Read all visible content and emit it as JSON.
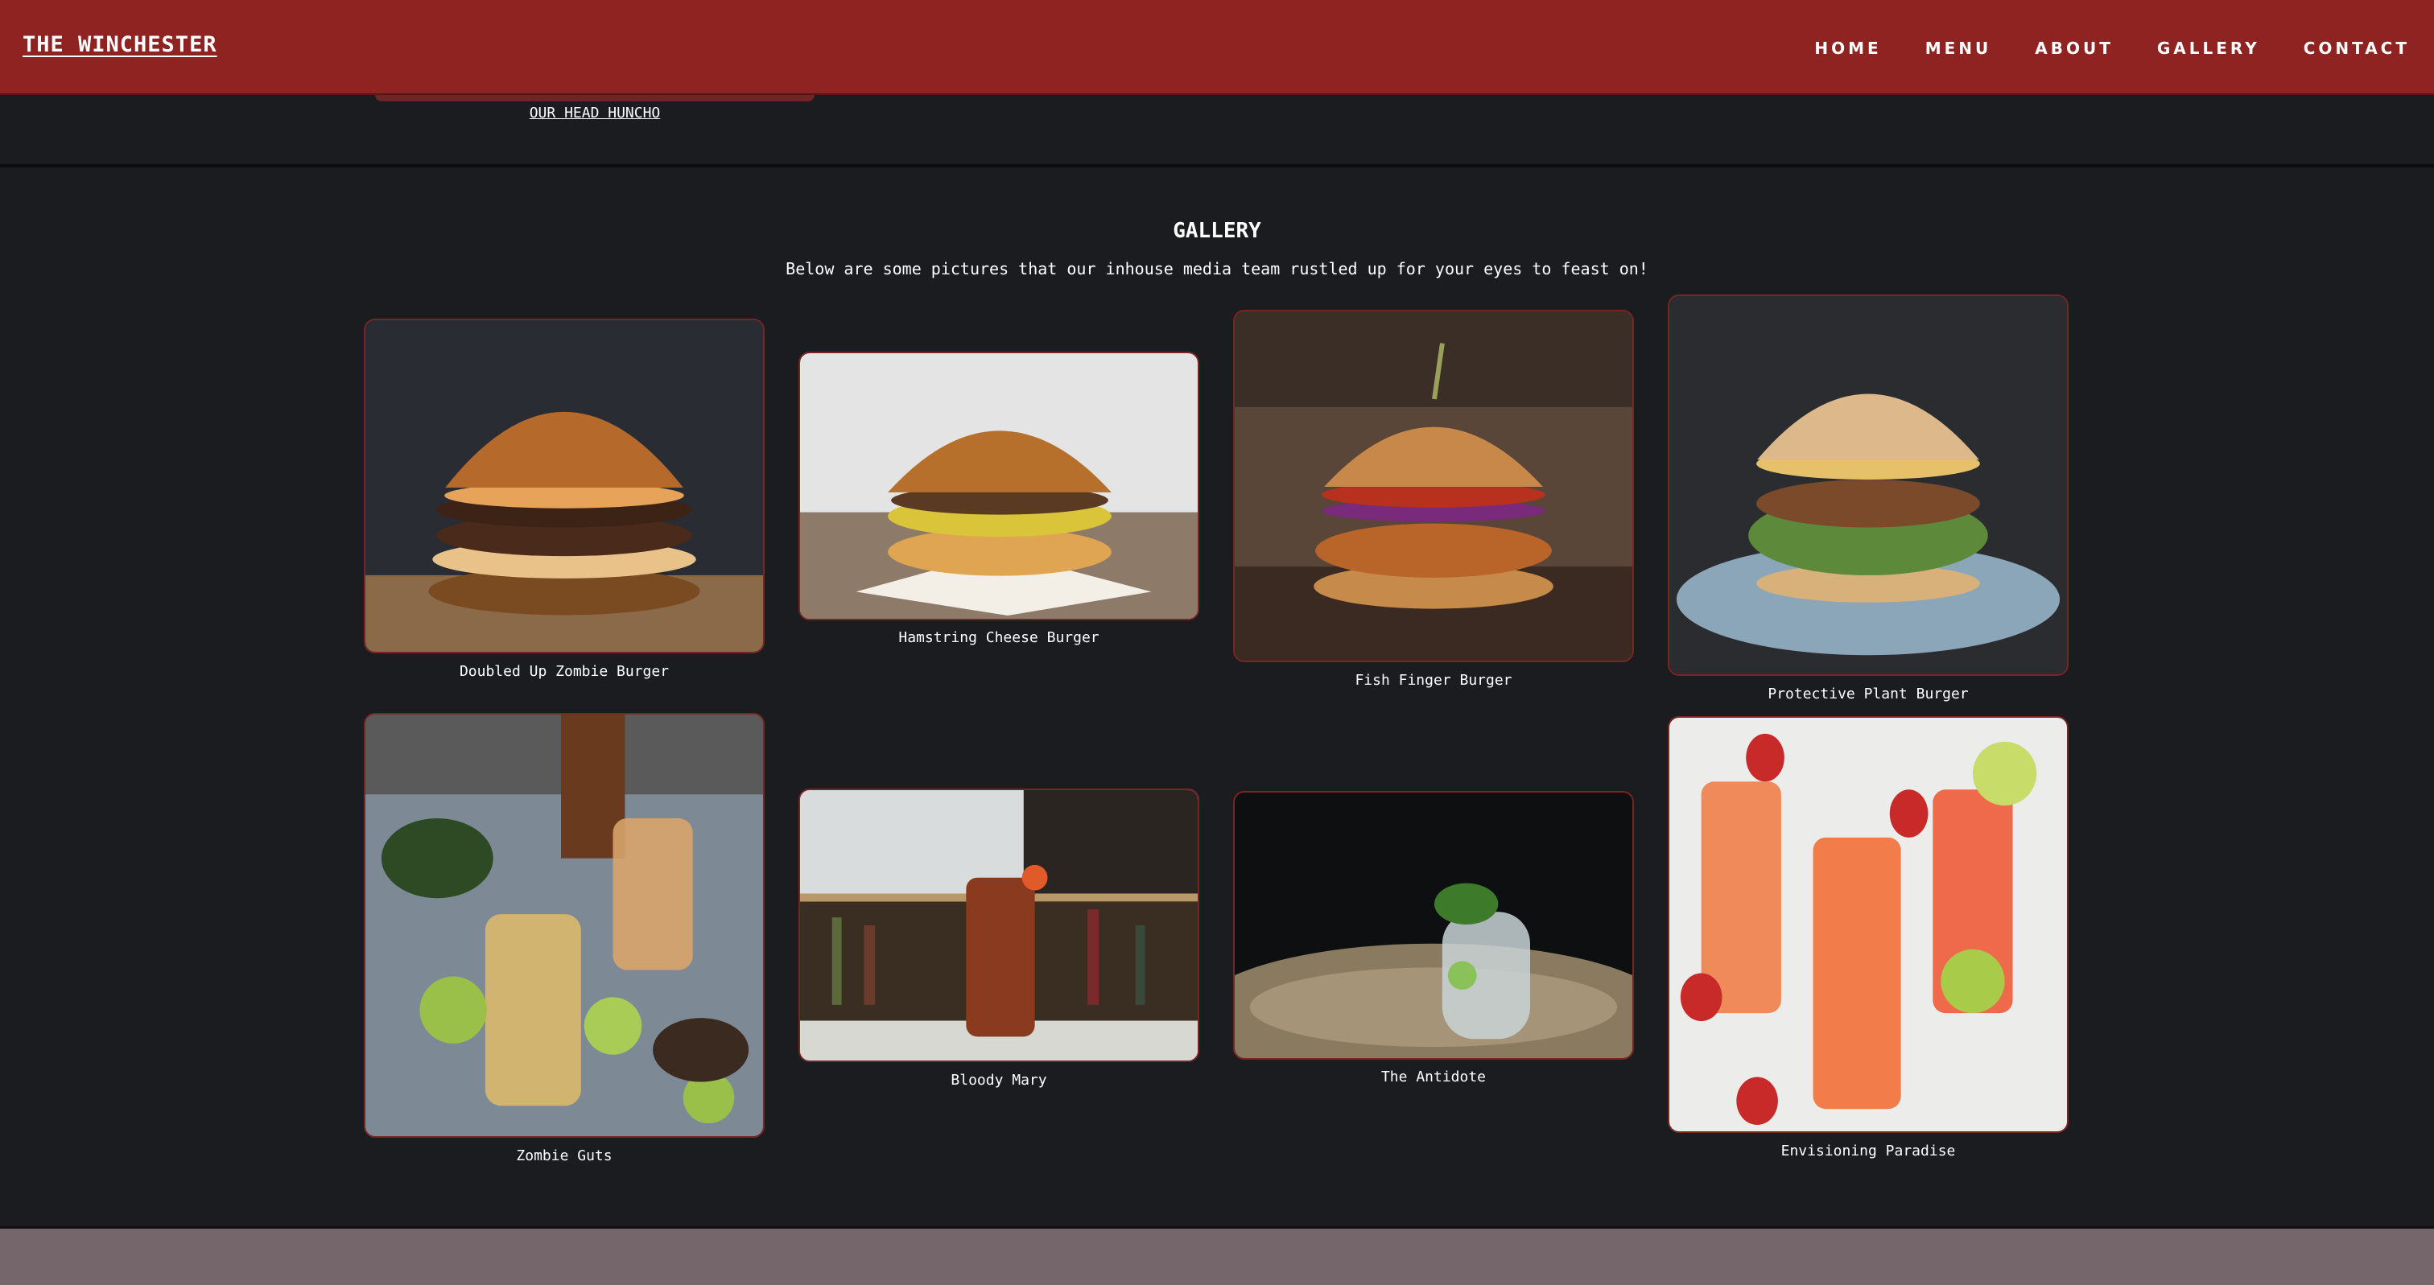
{
  "brand": "THE WINCHESTER",
  "nav": [
    "HOME",
    "MENU",
    "ABOUT",
    "GALLERY",
    "CONTACT"
  ],
  "about": {
    "caption": "OUR HEAD HUNCHO"
  },
  "gallery": {
    "title": "GALLERY",
    "subtitle": "Below are some pictures that our inhouse media team rustled up for your eyes to feast on!",
    "items": [
      {
        "caption": "Doubled Up Zombie Burger"
      },
      {
        "caption": "Hamstring Cheese Burger"
      },
      {
        "caption": "Fish Finger Burger"
      },
      {
        "caption": "Protective Plant Burger"
      },
      {
        "caption": "Zombie Guts"
      },
      {
        "caption": "Bloody Mary"
      },
      {
        "caption": "The Antidote"
      },
      {
        "caption": "Envisioning Paradise"
      }
    ]
  },
  "colors": {
    "header": "#8e2322",
    "page_bg": "#1b1c20",
    "card_border": "#7a2424",
    "footer": "#74666a"
  }
}
